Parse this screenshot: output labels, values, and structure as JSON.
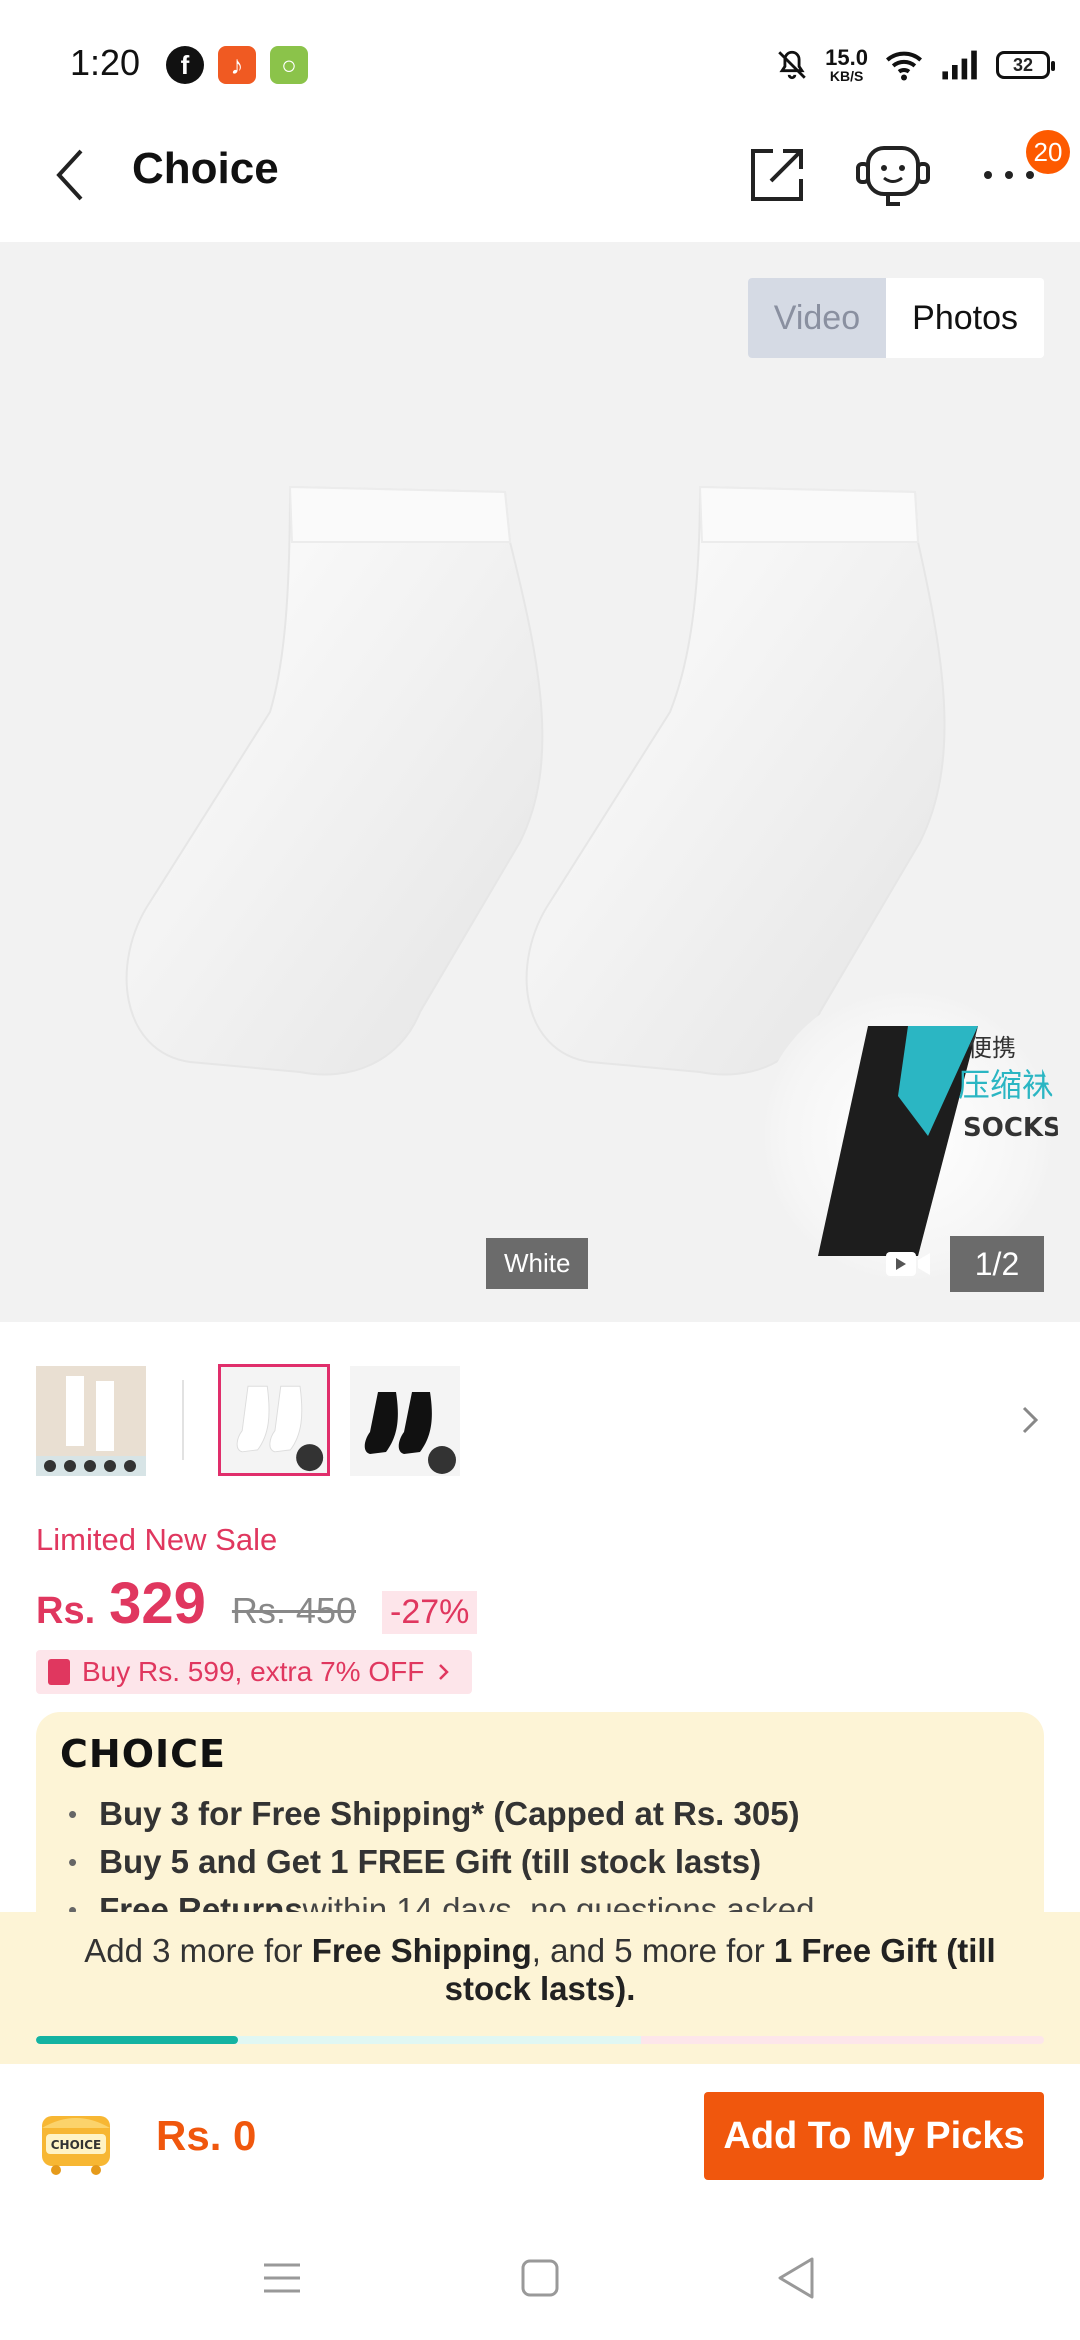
{
  "status_bar": {
    "time": "1:20",
    "net_speed_value": "15.0",
    "net_speed_unit": "KB/S",
    "battery": "32"
  },
  "header": {
    "title": "Choice",
    "notification_count": "20"
  },
  "gallery": {
    "media_tabs": [
      "Video",
      "Photos"
    ],
    "selected_tab": "Photos",
    "color_label": "White",
    "page_counter": "1/2"
  },
  "price": {
    "sale_label": "Limited New Sale",
    "currency": "Rs.",
    "current": "329",
    "original": "Rs. 450",
    "discount": "-27%",
    "promo": "Buy Rs. 599, extra 7% OFF"
  },
  "choice": {
    "logo": "CHOICE",
    "benefits": [
      {
        "bold": "Buy 3 for  Free Shipping* (Capped at Rs. 305)",
        "rest": ""
      },
      {
        "bold": "Buy 5 and Get 1 FREE Gift (till stock lasts)",
        "rest": ""
      },
      {
        "bold": "Free Returns",
        "rest": " within 14 days, no questions asked"
      }
    ]
  },
  "shipping_banner": {
    "prefix": "Add 3 more for ",
    "free_shipping": "Free Shipping",
    "middle": ", and 5 more for ",
    "free_gift": "1 Free Gift (till stock lasts).",
    "progress": 0.2
  },
  "bottom_bar": {
    "cart_badge": "CHOICE",
    "total": "Rs. 0",
    "add_button": "Add To My Picks"
  },
  "colors": {
    "accent_orange": "#f0570d",
    "sale_pink": "#e0375f",
    "choice_bg": "#fdf4d6",
    "progress_teal": "#14b3a1"
  }
}
